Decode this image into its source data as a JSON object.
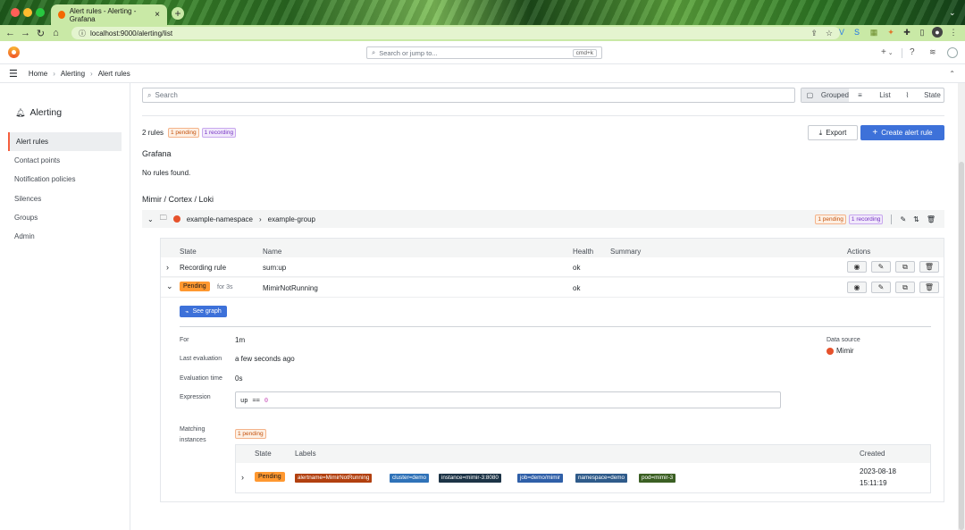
{
  "browser": {
    "tab_title": "Alert rules - Alerting - Grafana",
    "url": "localhost:9000/alerting/list"
  },
  "topbar": {
    "search_placeholder": "Search or jump to...",
    "search_shortcut": "cmd+k",
    "add_label": "+"
  },
  "breadcrumb": [
    "Home",
    "Alerting",
    "Alert rules"
  ],
  "sidebar": {
    "title": "Alerting",
    "items": [
      {
        "label": "Alert rules",
        "active": true
      },
      {
        "label": "Contact points",
        "active": false
      },
      {
        "label": "Notification policies",
        "active": false
      },
      {
        "label": "Silences",
        "active": false
      },
      {
        "label": "Groups",
        "active": false
      },
      {
        "label": "Admin",
        "active": false
      }
    ]
  },
  "filters": {
    "search_placeholder": "Search",
    "views": [
      "Grouped",
      "List",
      "State"
    ],
    "active_view": "Grouped"
  },
  "summary": {
    "count_label": "2 rules",
    "pending": "1 pending",
    "recording": "1 recording"
  },
  "actions": {
    "export": "Export",
    "create": "Create alert rule"
  },
  "sections": {
    "grafana_title": "Grafana",
    "grafana_empty": "No rules found.",
    "mimir_title": "Mimir / Cortex / Loki"
  },
  "group": {
    "namespace": "example-namespace",
    "name": "example-group",
    "pending": "1 pending",
    "recording": "1 recording"
  },
  "table": {
    "headers": [
      "State",
      "Name",
      "Health",
      "Summary",
      "Actions"
    ],
    "rows": [
      {
        "state": "Recording rule",
        "name": "sum:up",
        "health": "ok"
      },
      {
        "state": "Pending",
        "for": "for 3s",
        "name": "MimirNotRunning",
        "health": "ok"
      }
    ]
  },
  "details": {
    "see_graph": "See graph",
    "for_label": "For",
    "for_value": "1m",
    "last_eval_label": "Last evaluation",
    "last_eval_value": "a few seconds ago",
    "eval_time_label": "Evaluation time",
    "eval_time_value": "0s",
    "expression_label": "Expression",
    "expression_metric": "up",
    "expression_op": "==",
    "expression_num": "0",
    "datasource_label": "Data source",
    "datasource_value": "Mimir",
    "matching_label_1": "Matching",
    "matching_label_2": "instances",
    "matching_badge": "1 pending"
  },
  "instances": {
    "headers": [
      "State",
      "Labels",
      "Created"
    ],
    "row": {
      "state": "Pending",
      "labels": [
        "alertname=MimirNotRunning",
        "cluster=demo",
        "instance=mimir-3:8080",
        "job=demo/mimir",
        "namespace=demo",
        "pod=mimir-3"
      ],
      "created_date": "2023-08-18",
      "created_time": "15:11:19"
    }
  },
  "colors": {
    "accent": "#3d71d9",
    "pending": "#ff9830",
    "brand": "#f55f3e"
  }
}
